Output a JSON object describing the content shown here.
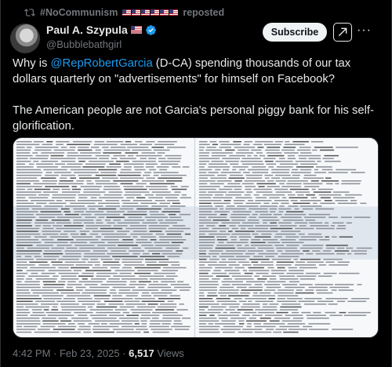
{
  "repost": {
    "account": "#NoCommunism",
    "flag_count": 6,
    "label": "reposted"
  },
  "author": {
    "name": "Paul A. Szypula",
    "handle": "@Bubblebathgirl"
  },
  "actions": {
    "subscribe_label": "Subscribe",
    "more_label": "···"
  },
  "tweet": {
    "line1_prefix": "Why is ",
    "mention": "@RepRobertGarcia",
    "line1_suffix": " (D-CA) spending thousands of our tax dollars quarterly on \"advertisements\" for himself on Facebook?",
    "paragraph2": "The American people are not Garcia's personal piggy bank for his self-glorification."
  },
  "meta": {
    "time": "4:42 PM",
    "separator": " · ",
    "date": "Feb 23, 2025",
    "views_count": "6,517",
    "views_label": " Views"
  },
  "colors": {
    "background": "#000000",
    "text": "#e7e9ea",
    "muted": "#71767b",
    "link": "#1d9bf0",
    "verified": "#1d9bf0"
  }
}
